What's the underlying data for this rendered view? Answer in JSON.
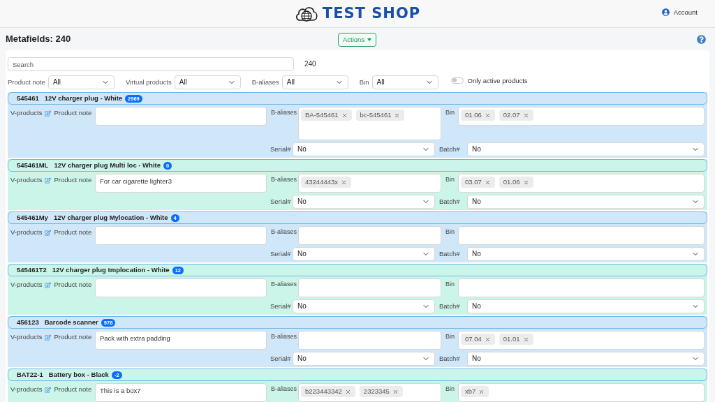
{
  "header": {
    "brand": "TEST SHOP",
    "account": "Account"
  },
  "toolbar": {
    "title": "Metafields: 240",
    "actions": "Actions"
  },
  "filters": {
    "search": {
      "placeholder": "Search"
    },
    "count": "240",
    "selects": [
      {
        "label": "Product note",
        "value": "All"
      },
      {
        "label": "Virtual products",
        "value": "All"
      },
      {
        "label": "B-aliases",
        "value": "All"
      },
      {
        "label": "Bin",
        "value": "All"
      }
    ],
    "toggle": {
      "label": "Only active products",
      "on": false
    }
  },
  "products": [
    {
      "sku": "545461",
      "name": "12V charger plug - White",
      "count": "2969",
      "color": "#cfe7f9",
      "v_label": "V-products",
      "note_label": "Product note",
      "aliases_label": "B-aliases",
      "aliases": [
        "BA-545461",
        "bc-545461"
      ],
      "bin_label": "Bin",
      "bins": [
        "01.06",
        "02.07"
      ],
      "serial_label": "Serial#",
      "serial": "No",
      "batch_label": "Batch#",
      "batch": "No"
    },
    {
      "sku": "545461ML",
      "name": "12V charger plug Multi loc - White",
      "count": "0",
      "color": "#ccf5ea",
      "v_label": "V-products",
      "note_label": "Product note",
      "note": "For car cigarette lighter3",
      "aliases_label": "B-aliases",
      "aliases": [
        "43244443x"
      ],
      "bin_label": "Bin",
      "bins": [
        "03.07",
        "01.06"
      ],
      "serial_label": "Serial#",
      "serial": "No",
      "batch_label": "Batch#",
      "batch": "No"
    },
    {
      "sku": "545461My",
      "name": "12V charger plug Mylocation - White",
      "count": "4",
      "color": "#cfe7f9",
      "v_label": "V-products",
      "note_label": "Product note",
      "aliases_label": "B-aliases",
      "bin_label": "Bin",
      "serial_label": "Serial#",
      "serial": "No",
      "batch_label": "Batch#",
      "batch": "No"
    },
    {
      "sku": "545461T2",
      "name": "12V charger plug tmplocation - White",
      "count": "12",
      "color": "#ccf5ea",
      "v_label": "V-products",
      "note_label": "Product note",
      "aliases_label": "B-aliases",
      "bin_label": "Bin",
      "serial_label": "Serial#",
      "serial": "No",
      "batch_label": "Batch#",
      "batch": "No"
    },
    {
      "sku": "456123",
      "name": "Barcode scanner",
      "count": "978",
      "color": "#cfe7f9",
      "v_label": "V-products",
      "note_label": "Product note",
      "note": "Pack with extra padding",
      "aliases_label": "B-aliases",
      "bin_label": "Bin",
      "bins": [
        "07.04",
        "01.01"
      ],
      "serial_label": "Serial#",
      "serial": "No",
      "batch_label": "Batch#",
      "batch": "No"
    },
    {
      "sku": "BAT22-1",
      "name": "Battery box - Black",
      "count": "-2",
      "color": "#ccf5ea",
      "v_label": "V-products",
      "note_label": "Product note",
      "note": "This is a box7",
      "aliases_label": "B-aliases",
      "aliases": [
        "b223443342",
        "2323345"
      ],
      "bin_label": "Bin",
      "bins": [
        "xb7"
      ]
    }
  ]
}
